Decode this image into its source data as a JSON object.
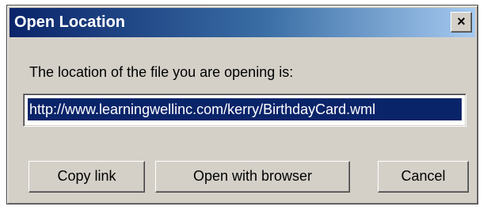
{
  "dialog": {
    "title": "Open Location",
    "close_glyph": "×",
    "message": "The location of the file you are opening is:",
    "location_url": "http://www.learningwellinc.com/kerry/BirthdayCard.wml"
  },
  "buttons": {
    "copy_link": "Copy link",
    "open_with_browser": "Open with browser",
    "cancel": "Cancel"
  },
  "colors": {
    "titlebar_start": "#0a246a",
    "titlebar_end": "#a6caf0",
    "dialog_face": "#d4d0c8",
    "selection": "#0a246a"
  },
  "icons": {
    "close": "close-icon"
  }
}
